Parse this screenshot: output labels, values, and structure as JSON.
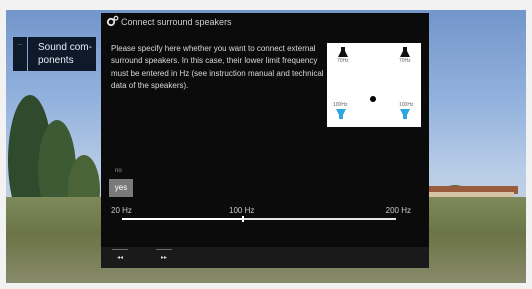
{
  "side_menu": {
    "small_tab": "...",
    "current": "Sound com-\nponents"
  },
  "dialog": {
    "title": "Connect surround speakers",
    "description": "Please specify here whether you want to connect external surround speakers. In this case, their lower limit frequency must be entered in Hz (see instruction manual and technical data of the speakers).",
    "diagram": {
      "labels": [
        "70Hz",
        "70Hz",
        "100Hz",
        "100Hz"
      ]
    },
    "options": {
      "no": "no",
      "yes": "yes",
      "selected": "yes"
    },
    "slider": {
      "min_label": "20 Hz",
      "mid_label": "100 Hz",
      "max_label": "200 Hz",
      "level": 0.44
    },
    "footer": {
      "back": "◂◂",
      "forward": "▸▸"
    }
  },
  "colors": {
    "dialog_bg": "#0b0b0b",
    "selected_option": "#7a7a7a",
    "speaker_blue": "#2aa7e0"
  }
}
